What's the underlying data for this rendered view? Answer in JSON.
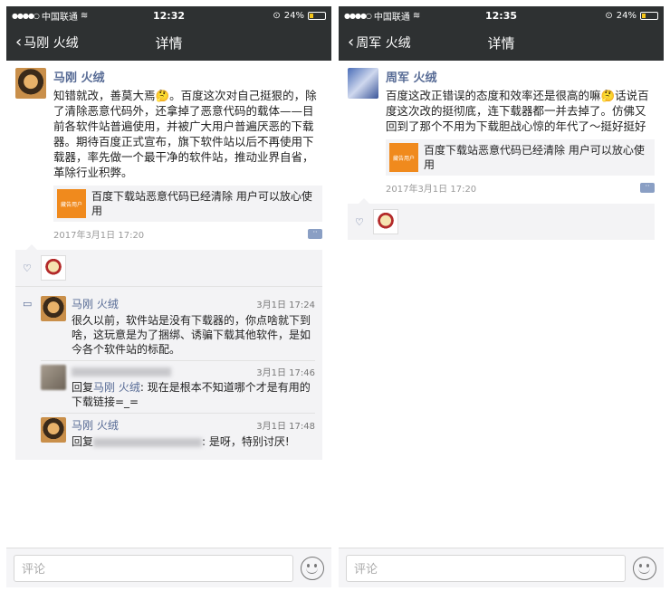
{
  "left": {
    "status": {
      "carrier": "中国联通",
      "time": "12:32",
      "battery": "24%",
      "battery_level": 0.24
    },
    "nav": {
      "back_label": "马刚 火绒",
      "title": "详情"
    },
    "post": {
      "author": "马刚 火绒",
      "text": "知错就改，善莫大焉🤔。百度这次对自己挺狠的，除了清除恶意代码外，还拿掉了恶意代码的载体——目前各软件站普遍使用，并被广大用户普遍厌恶的下载器。期待百度正式宣布，旗下软件站以后不再使用下载器，率先做一个最干净的软件站，推动业界自省，革除行业积弊。",
      "link_thumb": "藏告用户",
      "link_text": "百度下载站恶意代码已经清除 用户可以放心使用",
      "time": "2017年3月1日 17:20"
    },
    "comments": [
      {
        "author": "马刚 火绒",
        "time": "3月1日 17:24",
        "text": "很久以前，软件站是没有下载器的，你点啥就下到啥，这玩意是为了捆绑、诱骗下载其他软件，是如今各个软件站的标配。"
      },
      {
        "time": "3月1日 17:46",
        "reply_prefix": "回复",
        "reply_to": "马刚 火绒",
        "text": ": 现在是根本不知道哪个才是有用的下载链接=_="
      },
      {
        "author": "马刚 火绒",
        "time": "3月1日 17:48",
        "reply_prefix": "回复",
        "text": ": 是呀，特别讨厌!"
      }
    ],
    "input": {
      "placeholder": "评论"
    }
  },
  "right": {
    "status": {
      "carrier": "中国联通",
      "time": "12:35",
      "battery": "24%",
      "battery_level": 0.24
    },
    "nav": {
      "back_label": "周军 火绒",
      "title": "详情"
    },
    "post": {
      "author": "周军 火绒",
      "text": "百度这改正错误的态度和效率还是很高的嘛🤔话说百度这次改的挺彻底，连下载器都一并去掉了。仿佛又回到了那个不用为下载胆战心惊的年代了～挺好挺好",
      "link_thumb": "藏告用户",
      "link_text": "百度下载站恶意代码已经清除 用户可以放心使用",
      "time": "2017年3月1日 17:20"
    },
    "input": {
      "placeholder": "评论"
    }
  }
}
